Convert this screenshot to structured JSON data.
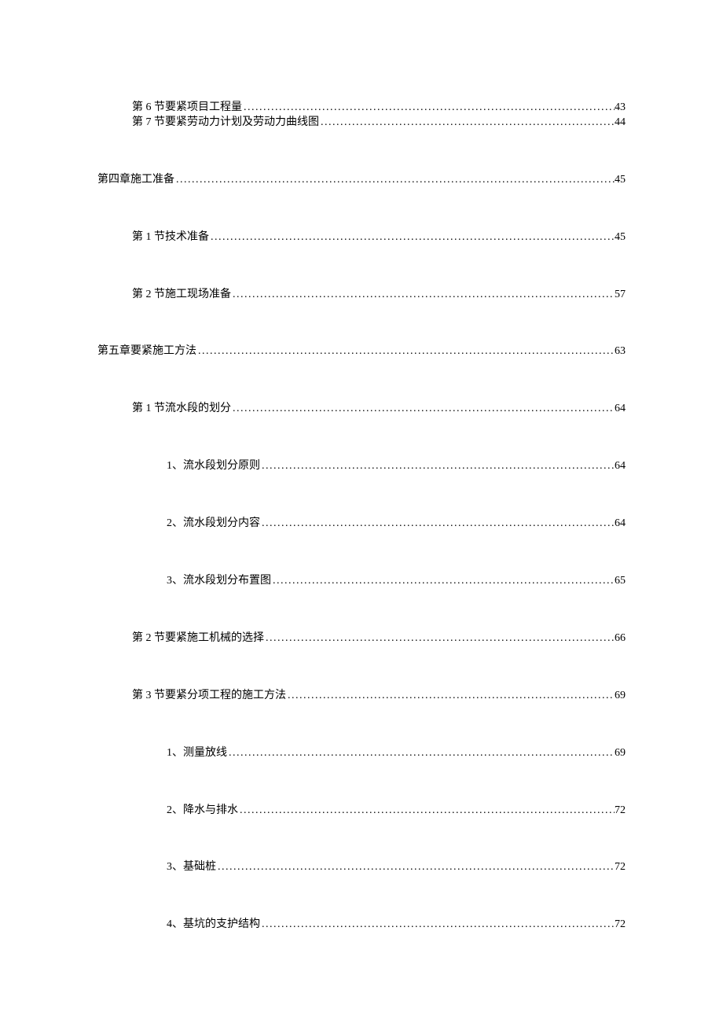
{
  "toc": [
    {
      "text": "第 6 节要紧项目工程量",
      "page": "43",
      "level": 1,
      "gap": "none"
    },
    {
      "text": "第 7 节要紧劳动力计划及劳动力曲线图",
      "page": "44",
      "level": 1,
      "gap": "small"
    },
    {
      "text": "第四章施工准备",
      "page": "45",
      "level": 0,
      "gap": "large"
    },
    {
      "text": "第 1 节技术准备",
      "page": "45",
      "level": 1,
      "gap": "large"
    },
    {
      "text": "第 2 节施工现场准备",
      "page": "57",
      "level": 1,
      "gap": "large"
    },
    {
      "text": "第五章要紧施工方法",
      "page": "63",
      "level": 0,
      "gap": "large"
    },
    {
      "text": "第 1 节流水段的划分",
      "page": "64",
      "level": 1,
      "gap": "large"
    },
    {
      "text": "1、流水段划分原则",
      "page": "64",
      "level": 2,
      "gap": "large"
    },
    {
      "text": "2、流水段划分内容",
      "page": "64",
      "level": 2,
      "gap": "large"
    },
    {
      "text": "3、流水段划分布置图",
      "page": "65",
      "level": 2,
      "gap": "large"
    },
    {
      "text": "第 2 节要紧施工机械的选择",
      "page": "66",
      "level": 1,
      "gap": "large"
    },
    {
      "text": "第 3 节要紧分项工程的施工方法",
      "page": "69",
      "level": 1,
      "gap": "large"
    },
    {
      "text": "1、测量放线",
      "page": "69",
      "level": 2,
      "gap": "large"
    },
    {
      "text": "2、降水与排水",
      "page": "72",
      "level": 2,
      "gap": "large"
    },
    {
      "text": "3、基础桩",
      "page": "72",
      "level": 2,
      "gap": "large"
    },
    {
      "text": "4、基坑的支护结构",
      "page": "72",
      "level": 2,
      "gap": "large"
    }
  ]
}
